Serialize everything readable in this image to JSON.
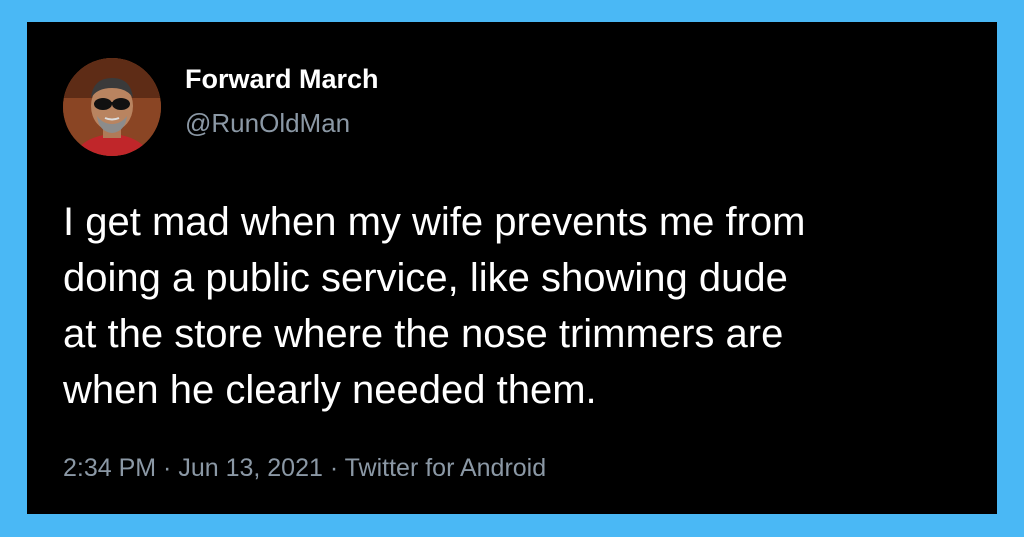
{
  "tweet": {
    "author_name": "Forward March",
    "author_handle": "@RunOldMan",
    "text_lines": [
      "I get mad when my wife prevents me from",
      "doing a public service, like showing dude",
      "at the store where the nose trimmers are",
      "when he clearly needed them."
    ],
    "timestamp": "2:34 PM · Jun 13, 2021 · Twitter for Android"
  },
  "colors": {
    "page_background": "#4ab8f5",
    "card_background": "#000000",
    "primary_text": "#ffffff",
    "secondary_text": "#8b98a5"
  }
}
